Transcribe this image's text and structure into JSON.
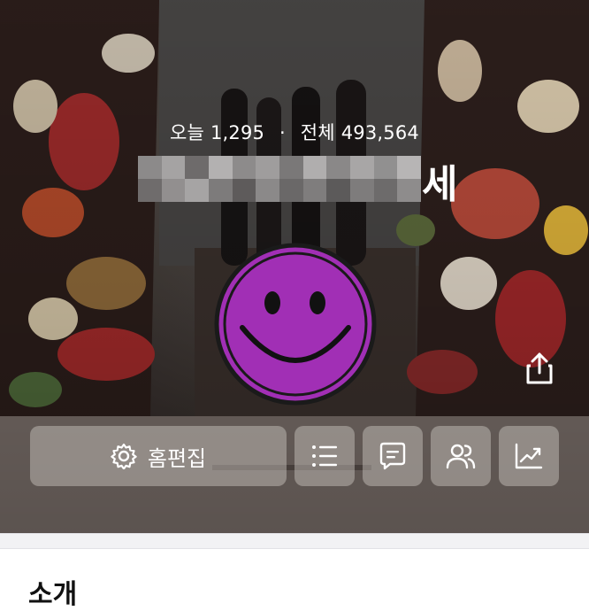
{
  "stats": {
    "today_label": "오늘",
    "today_value": "1,295",
    "separator": "·",
    "total_label": "전체",
    "total_value": "493,564"
  },
  "title": {
    "visible_suffix": "세"
  },
  "toolbar": {
    "edit_label": "홈편집"
  },
  "section": {
    "heading_peek": "소개"
  },
  "colors": {
    "smiley_fill": "#a12fb5",
    "smiley_ring": "#1a1a1a",
    "button_bg": "rgba(205,200,195,0.46)",
    "divider": "#f2f2f4"
  },
  "icons": [
    "gear-icon",
    "list-icon",
    "memo-icon",
    "people-icon",
    "stats-chart-icon",
    "share-icon",
    "smiley-face-icon"
  ]
}
